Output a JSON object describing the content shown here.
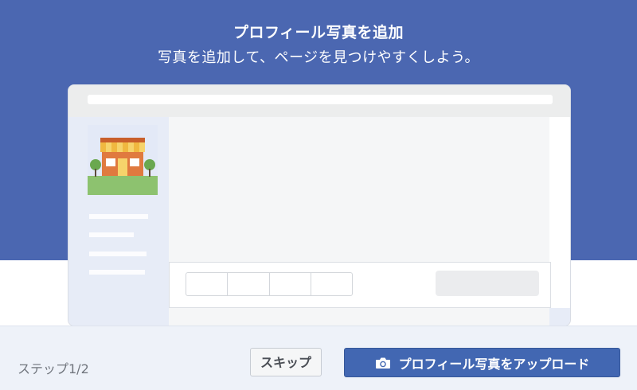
{
  "dialog": {
    "title": "プロフィール写真を追加",
    "subtitle": "写真を追加して、ページを見つけやすくしよう。"
  },
  "footer": {
    "step": "ステップ1/2",
    "skip_label": "スキップ",
    "upload_label": "プロフィール写真をアップロード"
  },
  "icons": {
    "camera": "camera-icon",
    "storefront": "storefront-illustration"
  },
  "colors": {
    "hero_bg": "#4b67b1",
    "primary_button": "#4267b2"
  }
}
